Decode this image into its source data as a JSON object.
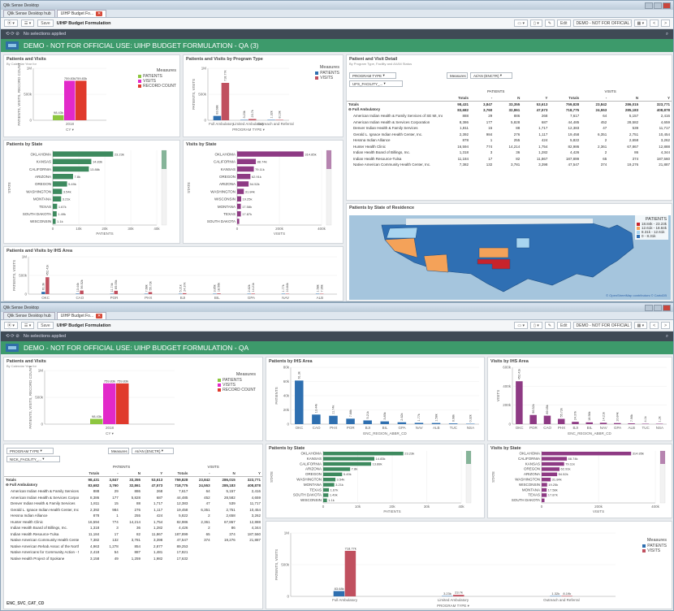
{
  "windows": [
    {
      "title": "Qlik Sense Desktop",
      "tabs": [
        {
          "label": "Qlik Sense Desktop hub"
        },
        {
          "label": "UIHP Budget Fo..."
        }
      ],
      "toolbar": {
        "save": "Save",
        "app_name": "UIHP Budget Formulation",
        "edit": "Edit",
        "sheet": "DEMO - NOT FOR OFFICIAL USE..."
      },
      "selection_text": "No selections applied",
      "header_title": "DEMO - NOT FOR OFFICIAL USE: UIHP BUDGET FORMULATION - QA (3)"
    },
    {
      "title": "Qlik Sense Desktop",
      "tabs": [
        {
          "label": "Qlik Sense Desktop hub"
        },
        {
          "label": "UIHP Budget Fo..."
        }
      ],
      "toolbar": {
        "save": "Save",
        "app_name": "UIHP Budget Formulation",
        "edit": "Edit",
        "sheet": "DEMO - NOT FOR OFFICIAL USE..."
      },
      "selection_text": "No selections applied",
      "header_title": "DEMO - NOT FOR OFFICIAL USE: UIHP BUDGET FORMULATION - QA"
    }
  ],
  "panels": {
    "patients_visits": {
      "title": "Patients and Visits",
      "subtitle": "By Calendar Year for"
    },
    "program_type": {
      "title": "Patients and Visits by Program Type"
    },
    "detail": {
      "title": "Patient and Visit Detail",
      "subtitle": "By Program Type, Facility and AI/AN Status"
    },
    "patients_state": {
      "title": "Patients by State"
    },
    "visits_state": {
      "title": "Visits by State"
    },
    "ihs_area": {
      "title": "Patients and Visits by IHS Area"
    },
    "map": {
      "title": "Patients by State of Residence",
      "legend_title": "PATIENTS",
      "attribution": "© OpenStreetMap contributors © CartoDB"
    },
    "patients_ihs": {
      "title": "Patients by IHS Area",
      "xlabel": "ENC_REGION_ABBR_CD"
    },
    "visits_ihs": {
      "title": "Visits by IHS Area",
      "xlabel": "ENC_REGION_ABBR_CD"
    }
  },
  "map_legend": [
    {
      "label": "18.84k - 23.23k",
      "color": "#c8232c"
    },
    {
      "label": "12.61k - 18.84k",
      "color": "#f4a259"
    },
    {
      "label": "8.31k - 12.61k",
      "color": "#a8d5f0"
    },
    {
      "label": "0 - 8.31k",
      "color": "#2f6fb3"
    }
  ],
  "filters": {
    "program_type": "PROGRAM TYPE",
    "aian": "AI/AN (ENCTR)",
    "facility1": "UFS_FACILITY_...",
    "facility2": "NICK_FACILITY_...",
    "footer": "ENC_SVC_CAT_CD",
    "cy": "CY",
    "program_type_axis": "PROGRAM TYPE"
  },
  "table": {
    "group_patients": "PATIENTS",
    "group_visits": "VISITS",
    "cols": [
      "Totals",
      "-",
      "N",
      "Y",
      "Totals",
      "-",
      "N",
      "Y"
    ],
    "rows": [
      {
        "name": "Totals",
        "v": [
          "98,431",
          "3,847",
          "33,355",
          "53,613",
          "759,828",
          "23,842",
          "286,015",
          "323,771"
        ]
      },
      {
        "name": "Full Ambulatory",
        "v": [
          "83,682",
          "3,760",
          "32,861",
          "47,573",
          "718,775",
          "24,553",
          "285,183",
          "408,878"
        ]
      },
      {
        "name": "American Indian Health & Family Services of SE MI, Inc.",
        "v": [
          "888",
          "29",
          "886",
          "268",
          "7,617",
          "64",
          "5,157",
          "2,416"
        ]
      },
      {
        "name": "American Indian Health & Services Corporation",
        "v": [
          "8,386",
          "177",
          "5,828",
          "687",
          "44,485",
          "452",
          "28,582",
          "4,659"
        ]
      },
      {
        "name": "Denver Indian Health & Family Services",
        "v": [
          "1,811",
          "15",
          "88",
          "1,717",
          "12,383",
          "47",
          "539",
          "11,717"
        ]
      },
      {
        "name": "Gerald L. Ignace Indian Health Center, Inc.",
        "v": [
          "2,392",
          "984",
          "276",
          "1,117",
          "19,458",
          "6,351",
          "2,751",
          "10,454"
        ]
      },
      {
        "name": "Hessna Indian Alliance",
        "v": [
          "878",
          "1",
          "255",
          "424",
          "5,822",
          "2",
          "2,658",
          "3,262"
        ]
      },
      {
        "name": "Hunter Health Clinic",
        "v": [
          "16,594",
          "774",
          "14,214",
          "1,754",
          "82,986",
          "2,361",
          "67,867",
          "12,888"
        ]
      },
      {
        "name": "Indian Health Board of Billings, Inc.",
        "v": [
          "1,318",
          "3",
          "36",
          "1,282",
          "4,426",
          "2",
          "86",
          "4,344"
        ]
      },
      {
        "name": "Indian Health Resource-Tulsa",
        "v": [
          "11,184",
          "17",
          "82",
          "11,867",
          "187,899",
          "65",
          "374",
          "187,560"
        ]
      },
      {
        "name": "Native American Community Health Center, Inc.",
        "v": [
          "7,382",
          "132",
          "3,781",
          "3,398",
          "47,547",
          "374",
          "19,276",
          "21,887"
        ]
      },
      {
        "name": "Native American Rehab Assoc of the Northwest, Inc.",
        "v": [
          "4,963",
          "1,278",
          "854",
          "2,877",
          "89,253",
          "",
          "",
          ""
        ]
      },
      {
        "name": "Native Americans for Community Action - NACA",
        "v": [
          "2,418",
          "54",
          "887",
          "1,481",
          "17,821",
          "",
          "",
          ""
        ]
      },
      {
        "name": "Native Health Project of Spokane",
        "v": [
          "3,158",
          "49",
          "1,259",
          "1,982",
          "17,632",
          "",
          "",
          ""
        ]
      }
    ]
  },
  "charts": {
    "pv_year": {
      "type": "bar",
      "categories": [
        "2018"
      ],
      "series": [
        {
          "name": "PATIENTS",
          "values": [
            98431
          ],
          "label": "98.43k",
          "color": "#8dc63f"
        },
        {
          "name": "VISITS",
          "values": [
            759828
          ],
          "label": "759.83k",
          "color": "#e229c9"
        },
        {
          "name": "RECORD COUNT",
          "values": [
            759828
          ],
          "label": "759.83k",
          "color": "#e03a2c"
        }
      ],
      "ylabel": "PATIENTS, VISITS, RECORD COUNT",
      "ylim": [
        0,
        1000000
      ],
      "yticks": [
        "0",
        "500k",
        "1M"
      ]
    },
    "program_type": {
      "type": "bar",
      "categories": [
        "Full Ambulatory",
        "Limited Ambulatory",
        "Outreach and Referral"
      ],
      "series": [
        {
          "name": "PATIENTS",
          "values": [
            83682,
            3230,
            1320
          ],
          "labels": [
            "83.68k",
            "3.23k",
            "1.32k"
          ],
          "color": "#2e6fb0"
        },
        {
          "name": "VISITS",
          "values": [
            718775,
            23700,
            8190
          ],
          "labels": [
            "718.77k",
            "23.7k",
            "8.19k"
          ],
          "color": "#c0505f"
        }
      ],
      "ylabel": "PATIENTS, VISITS",
      "ylim": [
        0,
        1000000
      ],
      "yticks": [
        "0",
        "500k",
        "1M"
      ]
    },
    "patients_state": {
      "type": "bar",
      "categories": [
        "OKLAHOMA",
        "KANSAS",
        "CALIFORNIA",
        "ARIZONA",
        "OREGON",
        "WASHINGTON",
        "MONTANA",
        "TEXAS",
        "SOUTH DAKOTA",
        "WISCONSIN"
      ],
      "values": [
        23230,
        14830,
        13880,
        7800,
        5490,
        3540,
        3210,
        1670,
        1490,
        1100
      ],
      "labels": [
        "23.23k",
        "14.83k",
        "13.88k",
        "7.8k",
        "5.49k",
        "3.54k",
        "3.21k",
        "1.67k",
        "1.49k",
        "1.1k"
      ],
      "color": "#3d8a5e",
      "xlabel": "PATIENTS",
      "ylabel": "STATE",
      "xlim": [
        0,
        40000
      ],
      "xticks": [
        "0",
        "10k",
        "20k",
        "30k",
        "40k"
      ]
    },
    "visits_state": {
      "type": "bar",
      "categories": [
        "OKLAHOMA",
        "CALIFORNIA",
        "KANSAS",
        "OREGON",
        "ARIZONA",
        "WASHINGTON",
        "WISCONSIN",
        "MONTANA",
        "TEXAS",
        "SOUTH DAKOTA"
      ],
      "values": [
        314850,
        88740,
        79110,
        62910,
        54520,
        31840,
        19250,
        17580,
        17870,
        10000
      ],
      "labels": [
        "314.85k",
        "88.74k",
        "79.11k",
        "62.91k",
        "54.52k",
        "31.84k",
        "19.25k",
        "17.58k",
        "17.87k",
        ""
      ],
      "color": "#8e3a84",
      "xlabel": "VISITS",
      "ylabel": "STATE",
      "xlim": [
        0,
        400000
      ],
      "xticks": [
        "0",
        "200k",
        "400k"
      ]
    },
    "ihs_area": {
      "type": "bar",
      "categories": [
        "OKC",
        "CAO",
        "POR",
        "PHX",
        "BJI",
        "BIL",
        "GPA",
        "NAV",
        "ALB"
      ],
      "series": [
        {
          "name": "PATIENTS",
          "values": [
            61300,
            13440,
            11740,
            7680,
            5210,
            3850,
            2620,
            1770,
            1580
          ],
          "labels": [
            "61.3k",
            "13.44k",
            "11.74k",
            "7.68k",
            "5.21k",
            "3.85k",
            "2.62k",
            "1.77k",
            "1.58k"
          ],
          "color": "#2e6fb0"
        },
        {
          "name": "VISITS",
          "values": [
            452410,
            96520,
            89050,
            55720,
            24370,
            18560,
            14210,
            10840,
            7960
          ],
          "labels": [
            "452.41k",
            "96.52k",
            "89.05k",
            "55.72k",
            "24.37k",
            "18.56k",
            "14.21k",
            "10.84k",
            "7.96k"
          ],
          "color": "#c0505f"
        }
      ],
      "ylabel": "PATIENTS, VISITS",
      "ylim": [
        0,
        1000000
      ],
      "yticks": [
        "0",
        "500k",
        "1M"
      ]
    },
    "patients_ihs": {
      "type": "bar",
      "categories": [
        "OKC",
        "CAO",
        "PHX",
        "POR",
        "BJI",
        "BIL",
        "GPA",
        "NAV",
        "ALB",
        "TUC",
        "NSA"
      ],
      "values": [
        61300,
        13440,
        11740,
        7680,
        5210,
        3850,
        2620,
        1770,
        1580,
        980,
        320
      ],
      "labels": [
        "61.3k",
        "13.44k",
        "11.74k",
        "7.68k",
        "5.21k",
        "3.85k",
        "2.62k",
        "1.77k",
        "1.58k",
        "0.98k",
        "0.32k"
      ],
      "color": "#2e6fb0",
      "ylabel": "PATIENTS",
      "ylim": [
        0,
        80000
      ],
      "yticks": [
        "0",
        "20k",
        "40k",
        "60k",
        "80k"
      ]
    },
    "visits_ihs": {
      "type": "bar",
      "categories": [
        "OKC",
        "POR",
        "CAO",
        "PHX",
        "BJI",
        "BIL",
        "NAV",
        "GPA",
        "ALB",
        "TUC",
        "NSA"
      ],
      "values": [
        452410,
        96520,
        89050,
        55720,
        24370,
        18560,
        14210,
        10840,
        7960,
        4100,
        1200
      ],
      "labels": [
        "452.41k",
        "96.52k",
        "89.05k",
        "55.72k",
        "24.37k",
        "18.56k",
        "14.21k",
        "10.84k",
        "7.96k",
        "4.1k",
        "1.2k"
      ],
      "color": "#8e3a84",
      "ylabel": "VISITS",
      "ylim": [
        0,
        600000
      ],
      "yticks": [
        "0",
        "200k",
        "400k",
        "600k"
      ]
    }
  }
}
